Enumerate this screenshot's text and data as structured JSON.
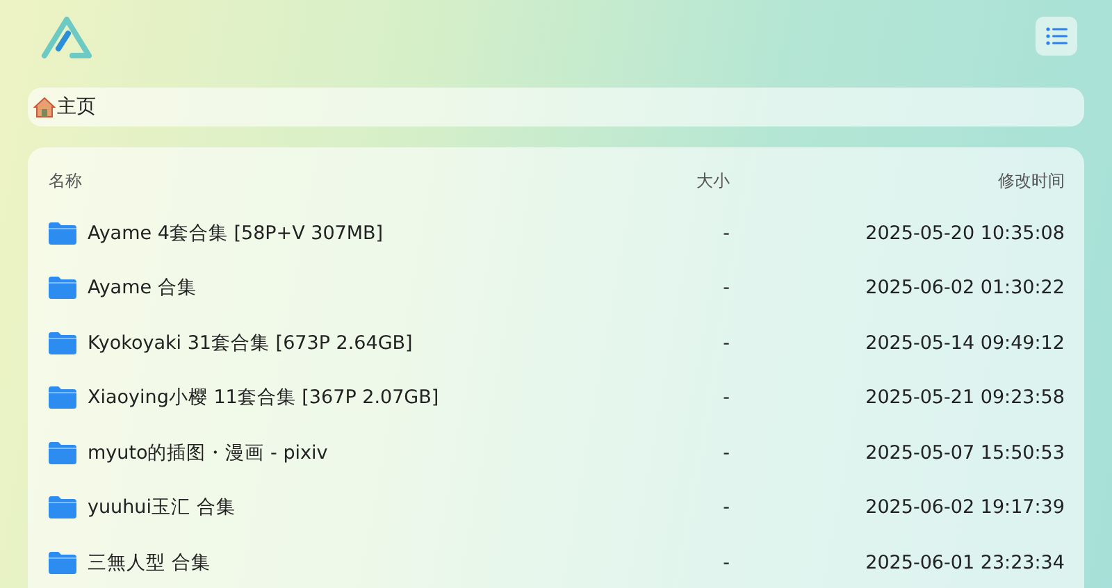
{
  "breadcrumb": {
    "label": "主页"
  },
  "table": {
    "columns": [
      "名称",
      "大小",
      "修改时间"
    ],
    "rows": [
      {
        "name": "Ayame 4套合集 [58P+V 307MB]",
        "size": "-",
        "modified": "2025-05-20 10:35:08"
      },
      {
        "name": "Ayame 合集",
        "size": "-",
        "modified": "2025-06-02 01:30:22"
      },
      {
        "name": "Kyokoyaki 31套合集 [673P 2.64GB]",
        "size": "-",
        "modified": "2025-05-14 09:49:12"
      },
      {
        "name": "Xiaoying小樱 11套合集 [367P 2.07GB]",
        "size": "-",
        "modified": "2025-05-21 09:23:58"
      },
      {
        "name": "myuto的插图・漫画 - pixiv",
        "size": "-",
        "modified": "2025-05-07 15:50:53"
      },
      {
        "name": "yuuhui玉汇 合集",
        "size": "-",
        "modified": "2025-06-02 19:17:39"
      },
      {
        "name": "三無人型 合集",
        "size": "-",
        "modified": "2025-06-01 23:23:34"
      }
    ]
  }
}
